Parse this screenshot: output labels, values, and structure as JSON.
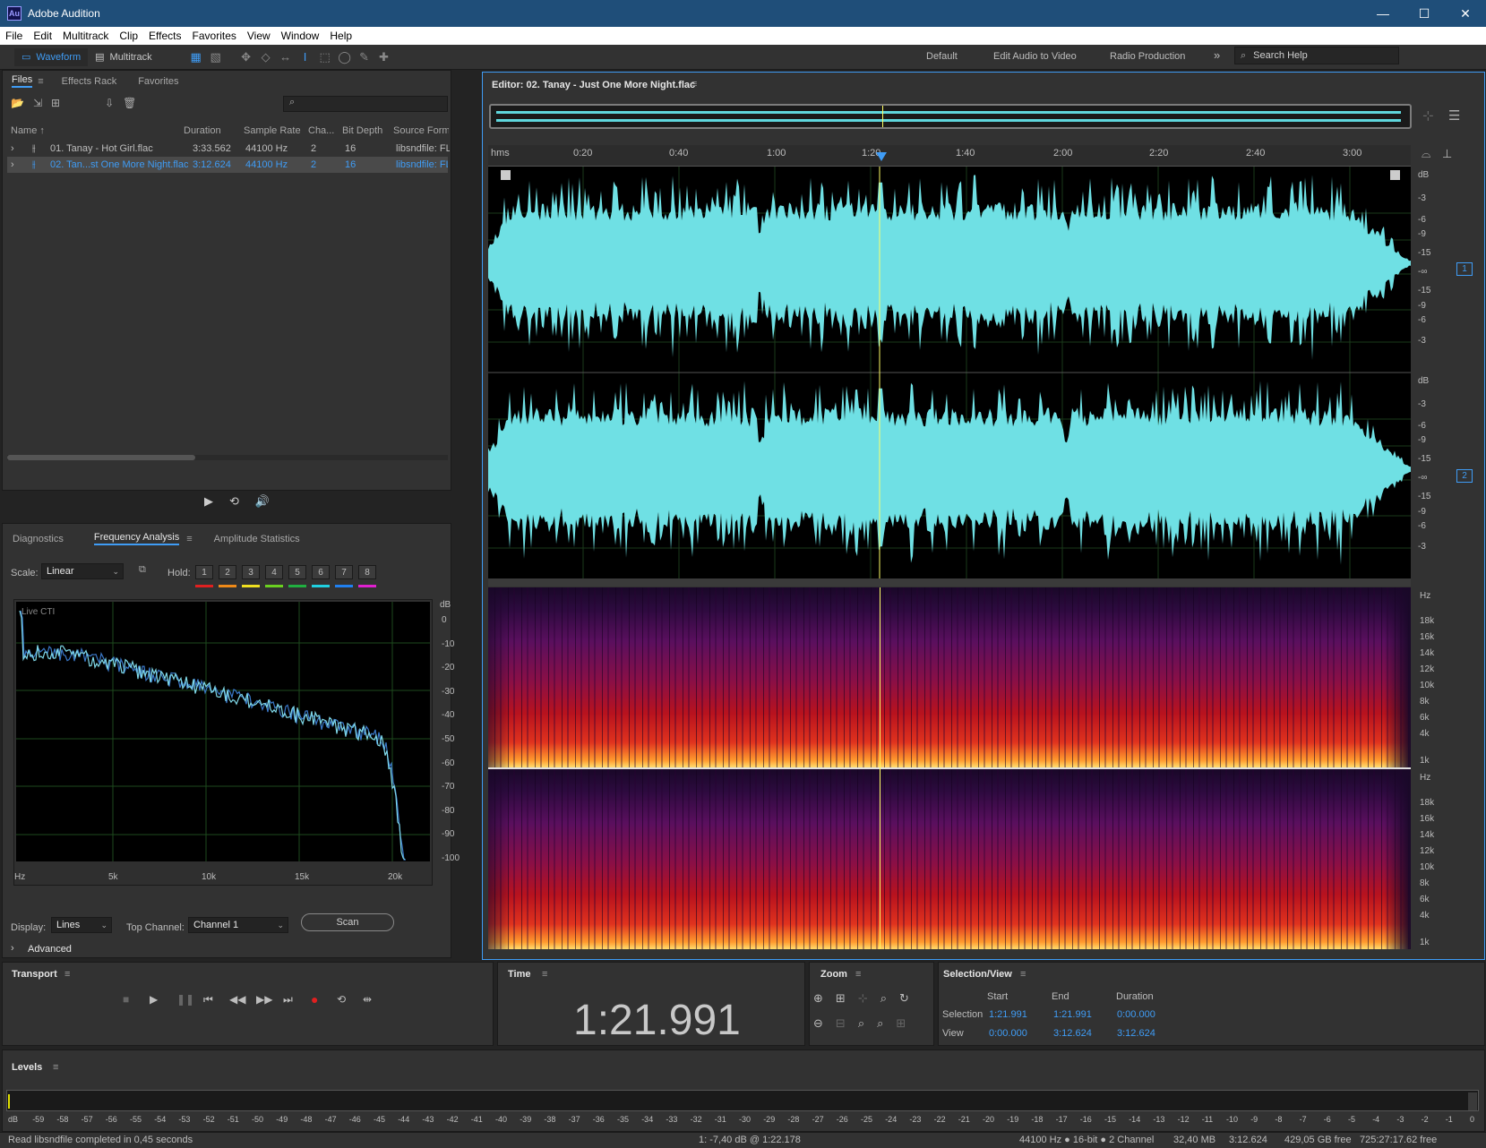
{
  "window": {
    "app_icon": "Au",
    "title": "Adobe Audition",
    "min": "—",
    "max": "☐",
    "close": "✕"
  },
  "menu": [
    "File",
    "Edit",
    "Multitrack",
    "Clip",
    "Effects",
    "Favorites",
    "View",
    "Window",
    "Help"
  ],
  "toolbar": {
    "waveform_label": "Waveform",
    "multitrack_label": "Multitrack",
    "workspaces": [
      "Default",
      "Edit Audio to Video",
      "Radio Production"
    ],
    "more": "»",
    "search_placeholder": "Search Help"
  },
  "files_panel": {
    "tabs": [
      "Files",
      "Effects Rack",
      "Favorites"
    ],
    "columns": [
      "Name ↑",
      "Duration",
      "Sample Rate",
      "Cha...",
      "Bit Depth",
      "Source Form..."
    ],
    "rows": [
      {
        "name": "01. Tanay - Hot Girl.flac",
        "duration": "3:33.562",
        "rate": "44100 Hz",
        "channels": "2",
        "bits": "16",
        "source": "libsndfile: FL"
      },
      {
        "name": "02. Tan...st One More Night.flac",
        "duration": "3:12.624",
        "rate": "44100 Hz",
        "channels": "2",
        "bits": "16",
        "source": "libsndfile: FL"
      }
    ]
  },
  "analysis_panel": {
    "tabs": [
      "Diagnostics",
      "Frequency Analysis",
      "Amplitude Statistics"
    ],
    "scale_label": "Scale:",
    "scale_value": "Linear",
    "hold_label": "Hold:",
    "hold_buttons": [
      "1",
      "2",
      "3",
      "4",
      "5",
      "6",
      "7",
      "8"
    ],
    "hold_colors": [
      "#e02020",
      "#f08a18",
      "#f0e020",
      "#6ad020",
      "#20b040",
      "#20d0e0",
      "#2080f0",
      "#e020d0"
    ],
    "live_label": "Live CTI",
    "db_unit": "dB",
    "db_ticks": [
      "0",
      "-10",
      "-20",
      "-30",
      "-40",
      "-50",
      "-60",
      "-70",
      "-80",
      "-90",
      "-100"
    ],
    "hz_ticks": [
      "Hz",
      "5k",
      "10k",
      "15k",
      "20k"
    ],
    "display_label": "Display:",
    "display_value": "Lines",
    "top_channel_label": "Top Channel:",
    "top_channel_value": "Channel 1",
    "scan_label": "Scan",
    "advanced_label": "Advanced"
  },
  "editor": {
    "title": "Editor: 02. Tanay - Just One More Night.flac",
    "ruler": [
      "hms",
      "0:20",
      "0:40",
      "1:00",
      "1:20",
      "1:40",
      "2:00",
      "2:20",
      "2:40",
      "3:00"
    ],
    "db_scale": [
      "dB",
      "-3",
      "-6",
      "-9",
      "-15",
      "-∞",
      "-15",
      "-9",
      "-6",
      "-3"
    ],
    "channel_1": "1",
    "channel_2": "2",
    "hz_scale": [
      "Hz",
      "18k",
      "16k",
      "14k",
      "12k",
      "10k",
      "8k",
      "6k",
      "4k",
      "1k"
    ]
  },
  "transport": {
    "title": "Transport"
  },
  "time": {
    "title": "Time",
    "value": "1:21.991"
  },
  "zoom": {
    "title": "Zoom"
  },
  "selection": {
    "title": "Selection/View",
    "headers": [
      "Start",
      "End",
      "Duration"
    ],
    "selection_label": "Selection",
    "selection": [
      "1:21.991",
      "1:21.991",
      "0:00.000"
    ],
    "view_label": "View",
    "view": [
      "0:00.000",
      "3:12.624",
      "3:12.624"
    ]
  },
  "levels": {
    "title": "Levels",
    "scale": [
      "dB",
      "-59",
      "-58",
      "-57",
      "-56",
      "-55",
      "-54",
      "-53",
      "-52",
      "-51",
      "-50",
      "-49",
      "-48",
      "-47",
      "-46",
      "-45",
      "-44",
      "-43",
      "-42",
      "-41",
      "-40",
      "-39",
      "-38",
      "-37",
      "-36",
      "-35",
      "-34",
      "-33",
      "-32",
      "-31",
      "-30",
      "-29",
      "-28",
      "-27",
      "-26",
      "-25",
      "-24",
      "-23",
      "-22",
      "-21",
      "-20",
      "-19",
      "-18",
      "-17",
      "-16",
      "-15",
      "-14",
      "-13",
      "-12",
      "-11",
      "-10",
      "-9",
      "-8",
      "-7",
      "-6",
      "-5",
      "-4",
      "-3",
      "-2",
      "-1",
      "0"
    ]
  },
  "status": {
    "message": "Read libsndfile completed in 0,45 seconds",
    "cursor": "1: -7,40 dB @ 1:22.178",
    "format": "44100 Hz ● 16-bit ● 2 Channel",
    "size": "32,40 MB",
    "duration": "3:12.624",
    "free": "429,05 GB free",
    "free_time": "725:27:17.62 free"
  }
}
